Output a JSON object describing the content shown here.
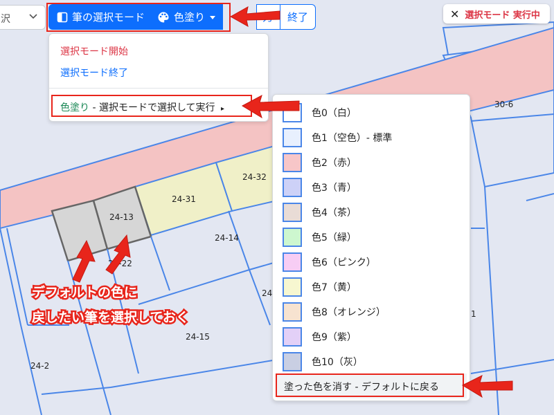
{
  "toolbar": {
    "select_partial": "沢",
    "mode_button": "筆の選択モード",
    "paint_button": "色塗り",
    "output_partial": "力",
    "end_button": "終了"
  },
  "status_badge": {
    "close_symbol": "✕",
    "label": "選択モード 実行中"
  },
  "dropdown_menu": {
    "start": "選択モード開始",
    "end": "選択モード終了",
    "paint_prefix": "色塗り",
    "paint_suffix": " - 選択モードで選択して実行",
    "arrow": "▸"
  },
  "color_menu": {
    "items": [
      {
        "label": "色0（白）",
        "color": "#ffffff"
      },
      {
        "label": "色1（空色）- 標準",
        "color": "#e8f0fe"
      },
      {
        "label": "色2（赤）",
        "color": "#f7c6c8"
      },
      {
        "label": "色3（青）",
        "color": "#cdd1f7"
      },
      {
        "label": "色4（茶）",
        "color": "#e9dcd6"
      },
      {
        "label": "色5（緑）",
        "color": "#cdf7cf"
      },
      {
        "label": "色6（ピンク）",
        "color": "#f7cdf4"
      },
      {
        "label": "色7（黄）",
        "color": "#f7f7d0"
      },
      {
        "label": "色8（オレンジ）",
        "color": "#f7e3d0"
      },
      {
        "label": "色9（紫）",
        "color": "#e3d0f7"
      },
      {
        "label": "色10（灰）",
        "color": "#c9cfe3"
      }
    ],
    "reset": "塗った色を消す - デフォルトに戻る"
  },
  "annotation": {
    "line1": "デフォルトの色に",
    "line2": "戻したい筆を選択しておく"
  },
  "map": {
    "parcels": [
      "30-6",
      "24-32",
      "24-31",
      "24-13",
      "24-14",
      "24-22",
      "24",
      "1",
      "24-15",
      "24-2"
    ]
  },
  "colors": {
    "primary": "#0d6efd",
    "annotation_red": "#e8251b",
    "road": "#f4c3c3",
    "parcel_border": "#4a86e8",
    "selected_parcel": "#d6d6d6",
    "yellow_parcel": "#f0f0c8"
  }
}
